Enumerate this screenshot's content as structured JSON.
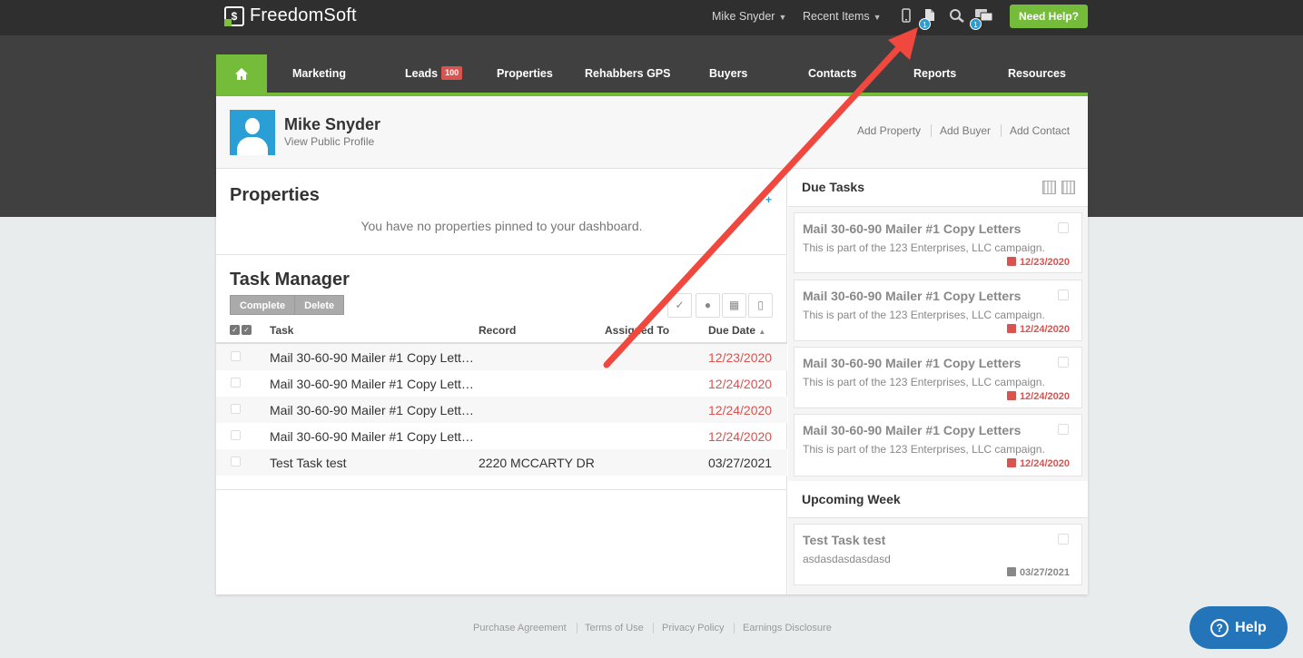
{
  "topbar": {
    "logo": "FreedomSoft",
    "user_menu": "Mike Snyder",
    "recent_items": "Recent Items",
    "icons": [
      "phone-icon",
      "document-icon",
      "search-icon",
      "chat-icon"
    ],
    "document_badge": "1",
    "chat_badge": "1",
    "need_help": "Need Help?"
  },
  "nav": {
    "home_icon": "home-icon",
    "items": [
      {
        "label": "Marketing"
      },
      {
        "label": "Leads",
        "badge": "100"
      },
      {
        "label": "Properties"
      },
      {
        "label": "Rehabbers GPS"
      },
      {
        "label": "Buyers"
      },
      {
        "label": "Contacts"
      },
      {
        "label": "Reports"
      },
      {
        "label": "Resources"
      }
    ]
  },
  "profile": {
    "name": "Mike Snyder",
    "link": "View Public Profile",
    "actions": [
      "Add Property",
      "Add Buyer",
      "Add Contact"
    ]
  },
  "properties": {
    "title": "Properties",
    "empty_message": "You have no properties pinned to your dashboard.",
    "add_symbol": "+"
  },
  "task_manager": {
    "title": "Task Manager",
    "buttons": [
      "Complete",
      "Delete"
    ],
    "columns": [
      "Task",
      "Record",
      "Assigned To",
      "Due Date"
    ],
    "rows": [
      {
        "task": "Mail 30-60-90 Mailer #1 Copy Lett…",
        "record": "",
        "assigned": "",
        "due": "12/23/2020",
        "overdue": true
      },
      {
        "task": "Mail 30-60-90 Mailer #1 Copy Lett…",
        "record": "",
        "assigned": "",
        "due": "12/24/2020",
        "overdue": true
      },
      {
        "task": "Mail 30-60-90 Mailer #1 Copy Lett…",
        "record": "",
        "assigned": "",
        "due": "12/24/2020",
        "overdue": true
      },
      {
        "task": "Mail 30-60-90 Mailer #1 Copy Lett…",
        "record": "",
        "assigned": "",
        "due": "12/24/2020",
        "overdue": true
      },
      {
        "task": "Test Task test",
        "record": "2220 MCCARTY DR",
        "assigned": "",
        "due": "03/27/2021",
        "overdue": false
      }
    ]
  },
  "due_tasks": {
    "title": "Due Tasks",
    "cards": [
      {
        "title": "Mail 30-60-90 Mailer #1 Copy Letters",
        "sub": "This is part of the 123 Enterprises, LLC campaign.",
        "date": "12/23/2020"
      },
      {
        "title": "Mail 30-60-90 Mailer #1 Copy Letters",
        "sub": "This is part of the 123 Enterprises, LLC campaign.",
        "date": "12/24/2020"
      },
      {
        "title": "Mail 30-60-90 Mailer #1 Copy Letters",
        "sub": "This is part of the 123 Enterprises, LLC campaign.",
        "date": "12/24/2020"
      },
      {
        "title": "Mail 30-60-90 Mailer #1 Copy Letters",
        "sub": "This is part of the 123 Enterprises, LLC campaign.",
        "date": "12/24/2020"
      }
    ]
  },
  "upcoming_week": {
    "title": "Upcoming Week",
    "cards": [
      {
        "title": "Test Task test",
        "sub": "asdasdasdasdasd",
        "date": "03/27/2021"
      }
    ]
  },
  "footer": {
    "links": [
      "Purchase Agreement",
      "Terms of Use",
      "Privacy Policy",
      "Earnings Disclosure"
    ]
  },
  "help_widget": {
    "label": "Help"
  },
  "colors": {
    "brand_green": "#74bc3a",
    "accent_blue": "#2a9fd6",
    "overdue_red": "#d9534f",
    "annotation_arrow": "#f0483e"
  }
}
